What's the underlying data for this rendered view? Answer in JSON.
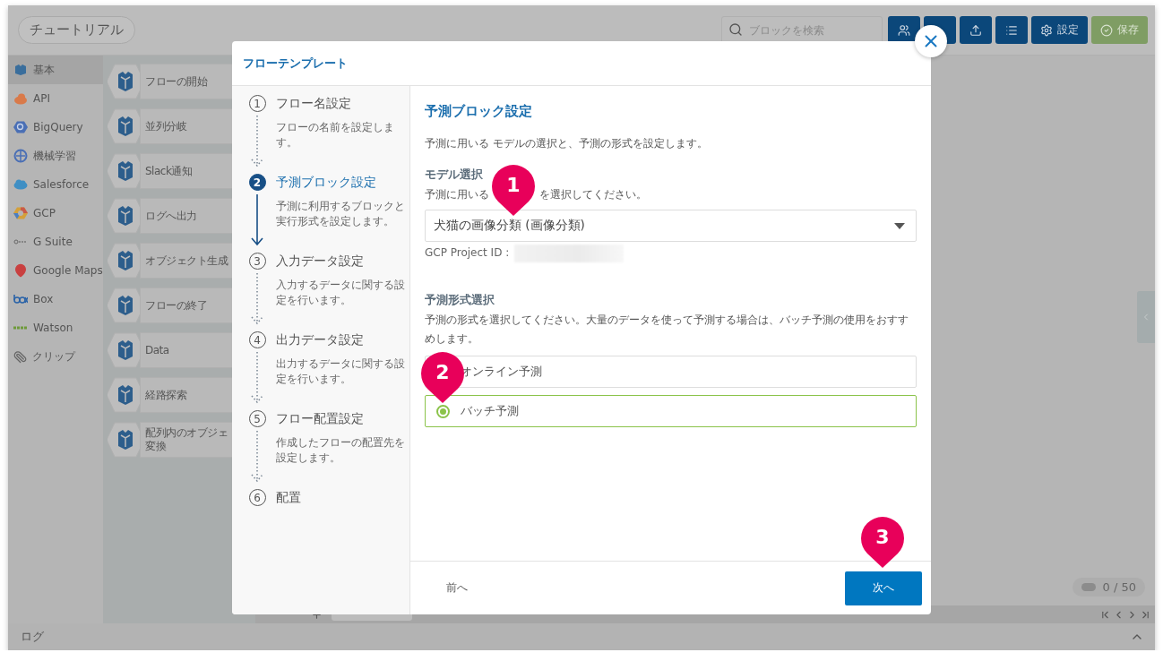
{
  "header": {
    "title": "チュートリアル",
    "search": {
      "placeholder": "ブロックを検索"
    },
    "buttons": [
      {
        "kind": "people"
      },
      {
        "kind": "covered"
      },
      {
        "kind": "upload"
      },
      {
        "kind": "list"
      },
      {
        "kind": "settings",
        "label": "設定"
      },
      {
        "kind": "save",
        "label": "保存"
      }
    ]
  },
  "sidebar": {
    "items": [
      {
        "kind": "basic",
        "label": "基本",
        "selected": true
      },
      {
        "kind": "api",
        "label": "API",
        "selected": false
      },
      {
        "kind": "bigquery",
        "label": "BigQuery",
        "selected": false
      },
      {
        "kind": "ml",
        "label": "機械学習",
        "selected": false
      },
      {
        "kind": "salesforce",
        "label": "Salesforce",
        "selected": false
      },
      {
        "kind": "gcp",
        "label": "GCP",
        "selected": false
      },
      {
        "kind": "gsuite",
        "label": "G Suite",
        "selected": false
      },
      {
        "kind": "maps",
        "label": "Google Maps",
        "selected": false
      },
      {
        "kind": "box",
        "label": "Box",
        "selected": false
      },
      {
        "kind": "watson",
        "label": "Watson",
        "selected": false
      },
      {
        "kind": "clip",
        "label": "クリップ",
        "selected": false
      }
    ]
  },
  "blocks": [
    {
      "lines": [
        "フローの開始"
      ]
    },
    {
      "lines": [
        "並列分岐"
      ]
    },
    {
      "lines": [
        "Slack通知"
      ]
    },
    {
      "lines": [
        "ログへ出力"
      ]
    },
    {
      "lines": [
        "オブジェクト生成"
      ]
    },
    {
      "lines": [
        "フローの終了"
      ]
    },
    {
      "lines": [
        "Data"
      ]
    },
    {
      "lines": [
        "経路探索"
      ]
    },
    {
      "lines": [
        "配列内のオブジェ",
        "変換"
      ]
    }
  ],
  "canvas": {
    "counter": "0 / 50"
  },
  "log_bar": {
    "label": "ログ"
  },
  "modal": {
    "title": "フローテンプレート",
    "steps": [
      {
        "number": "1",
        "title": "フロー名設定",
        "description": "フローの名前を設定します。",
        "selected": false
      },
      {
        "number": "2",
        "title": "予測ブロック設定",
        "description": "予測に利用するブロックと実行形式を設定します。",
        "selected": true
      },
      {
        "number": "3",
        "title": "入力データ設定",
        "description": "入力するデータに関する設定を行います。",
        "selected": false
      },
      {
        "number": "4",
        "title": "出力データ設定",
        "description": "出力するデータに関する設定を行います。",
        "selected": false
      },
      {
        "number": "5",
        "title": "フロー配置設定",
        "description": "作成したフローの配置先を設定します。",
        "selected": false
      },
      {
        "number": "6",
        "title": "配置",
        "selected": false
      }
    ],
    "content": {
      "title": "予測ブロック設定",
      "description": "予測に用いる モデルの選択と、予測の形式を設定します。",
      "model": {
        "heading": "モデル選択",
        "hint_parts": [
          "予測に用いる",
          "を選択してください。"
        ],
        "value": "犬猫の画像分類 (画像分類)",
        "project_label": "GCP Project ID :"
      },
      "format": {
        "heading": "予測形式選択",
        "hint": "予測の形式を選択してください。大量のデータを使って予測する場合は、バッチ予測の使用をおすすめします。",
        "options": [
          {
            "label": "オンライン予測",
            "selected": false
          },
          {
            "label": "バッチ予測",
            "selected": true
          }
        ]
      }
    },
    "footer": {
      "back": "前へ",
      "next": "次へ"
    }
  },
  "markers": [
    {
      "number": "1"
    },
    {
      "number": "2"
    },
    {
      "number": "3"
    }
  ]
}
